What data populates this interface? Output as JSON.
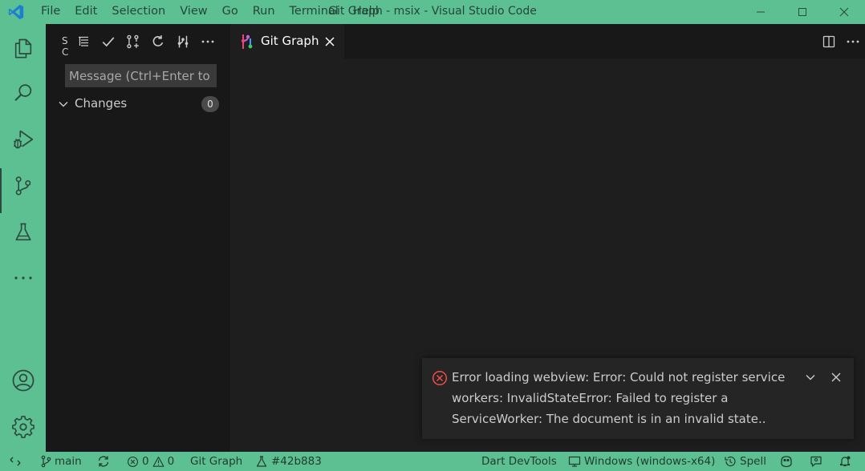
{
  "window": {
    "title": "Git Graph - msix - Visual Studio Code",
    "menu": [
      "File",
      "Edit",
      "Selection",
      "View",
      "Go",
      "Run",
      "Terminal",
      "Help"
    ]
  },
  "colors": {
    "accent": "#5dc092",
    "sidebar_bg": "#181818",
    "editor_bg": "#1e1e1e",
    "error": "#f14c4c"
  },
  "activitybar": {
    "items": [
      "explorer-icon",
      "search-icon",
      "run-debug-icon",
      "source-control-icon",
      "testing-icon",
      "more-icon"
    ],
    "bottom": [
      "account-icon",
      "manage-gear-icon"
    ]
  },
  "sidebar": {
    "title": "SOURCE CONTROL",
    "commit_placeholder": "Message (Ctrl+Enter to c...",
    "changes_label": "Changes",
    "changes_count": "0"
  },
  "editor": {
    "tab_label": "Git Graph"
  },
  "notification": {
    "message": "Error loading webview: Error: Could not register service workers: InvalidStateError: Failed to register a ServiceWorker: The document is in an invalid state.."
  },
  "statusbar": {
    "branch": "main",
    "errors": "0",
    "warnings": "0",
    "git_graph": "Git Graph",
    "commit": "#42b883",
    "dart_devtools": "Dart DevTools",
    "platform": "Windows (windows-x64)",
    "spell": "Spell"
  }
}
